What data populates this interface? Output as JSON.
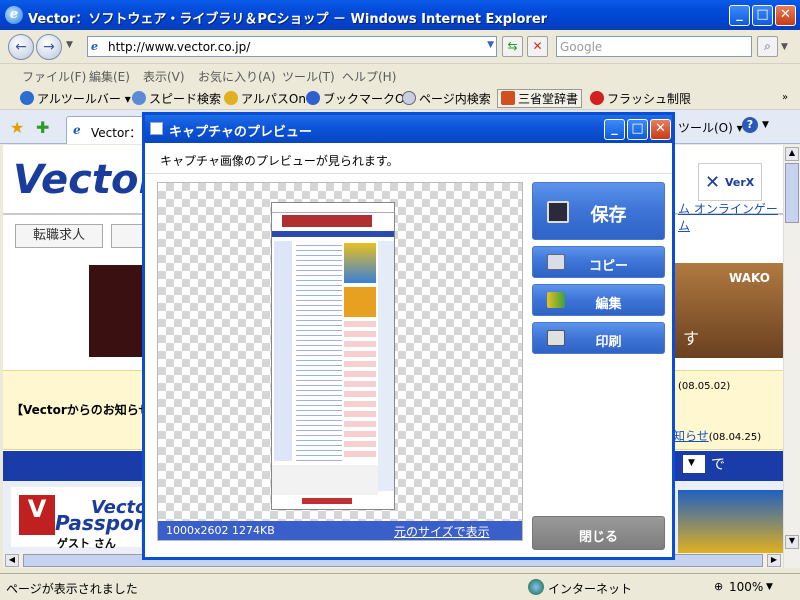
{
  "browser": {
    "title": "Vector：ソフトウェア・ライブラリ＆PCショップ － Windows Internet Explorer",
    "address": "http://www.vector.co.jp/",
    "search_placeholder": "Google",
    "menu": [
      "ファイル(F)",
      "編集(E)",
      "表示(V)",
      "お気に入り(A)",
      "ツール(T)",
      "ヘルプ(H)"
    ],
    "linkbar": [
      "アルツールバー ▾",
      "スピード検索",
      "アルパスOn",
      "ブックマークOn",
      "ページ内検索",
      "三省堂辞書",
      "フラッシュ制限"
    ],
    "tab_label": "Vector：ソ",
    "tools_label": "ツール(O) ▾",
    "status": "ページが表示されました",
    "zone": "インターネット",
    "zoom": "100%"
  },
  "webpage": {
    "logo": "Vector",
    "tab_button": "転職求人",
    "online_game": "オンラインゲーム",
    "verx": "VerX",
    "notice": "【Vectorからのお知らせ",
    "date1": "(08.05.02)",
    "date2_link": "知らせ",
    "date2": "(08.04.25)",
    "de": "で",
    "wako": "WAKO",
    "su": "す",
    "passport_brand": "Vector",
    "passport": "Passpor",
    "guest": "ゲスト さん"
  },
  "dialog": {
    "title": "キャプチャのプレビュー",
    "description": "キャプチャ画像のプレビューが見られます。",
    "dims": "1000x2602  1274KB",
    "original_size_link": "元のサイズで表示",
    "save": "保存",
    "copy": "コピー",
    "edit": "編集",
    "print": "印刷",
    "close": "閉じる"
  },
  "colors": {
    "xp_blue": "#0a4ed6",
    "button_blue": "#3d74d6",
    "close_gray": "#8a8a8a"
  }
}
